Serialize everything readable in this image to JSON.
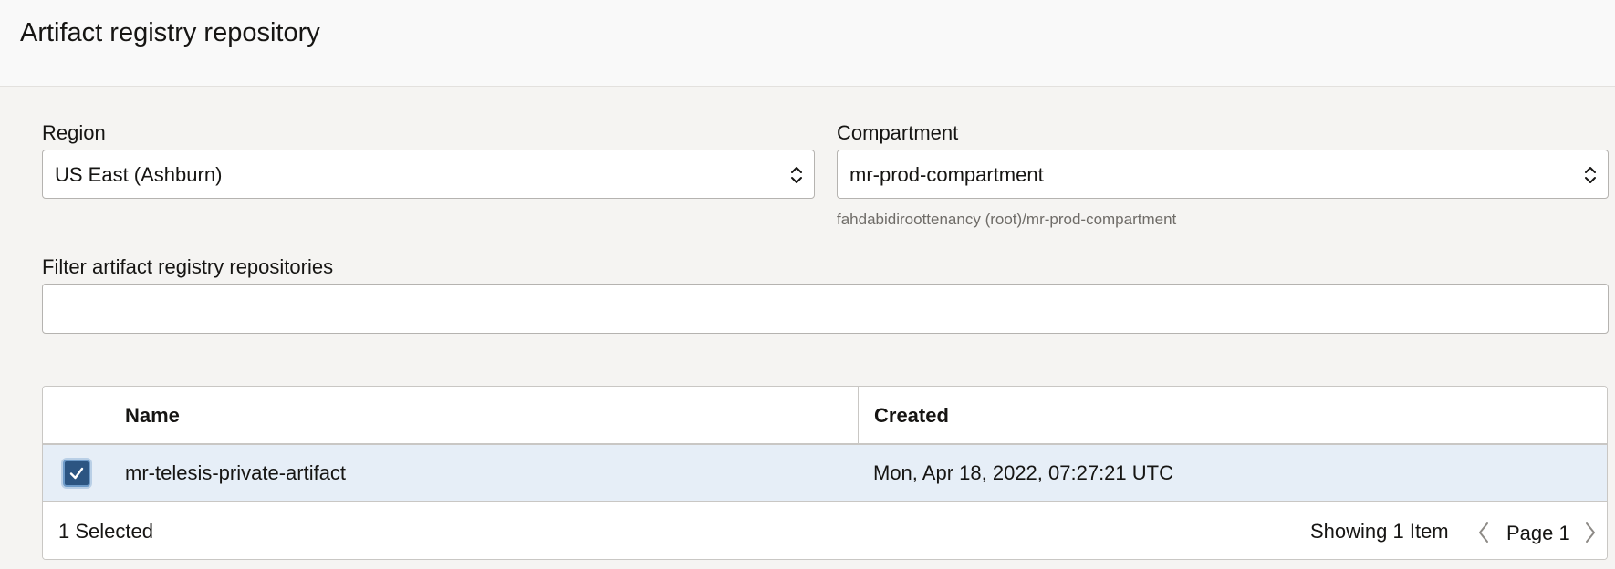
{
  "header": {
    "title": "Artifact registry repository"
  },
  "region": {
    "label": "Region",
    "value": "US East (Ashburn)"
  },
  "compartment": {
    "label": "Compartment",
    "value": "mr-prod-compartment",
    "path": "fahdabidiroottenancy (root)/mr-prod-compartment"
  },
  "filter": {
    "label": "Filter artifact registry repositories",
    "value": "",
    "placeholder": ""
  },
  "table": {
    "columns": [
      "Name",
      "Created"
    ],
    "rows": [
      {
        "name": "mr-telesis-private-artifact",
        "created": "Mon, Apr 18, 2022, 07:27:21 UTC",
        "selected": true
      }
    ],
    "footer": {
      "selected_text": "1 Selected",
      "showing_text": "Showing 1 Item",
      "page_text": "Page 1"
    }
  },
  "colors": {
    "accent": "#2c5582",
    "selected_row": "#e6eef7",
    "border": "#b5b3b0",
    "background": "#f5f4f2"
  },
  "icons": {
    "select_chevrons": "up-down-chevron-icon",
    "checkbox": "checkmark-icon",
    "prev": "chevron-left-icon",
    "next": "chevron-right-icon"
  }
}
